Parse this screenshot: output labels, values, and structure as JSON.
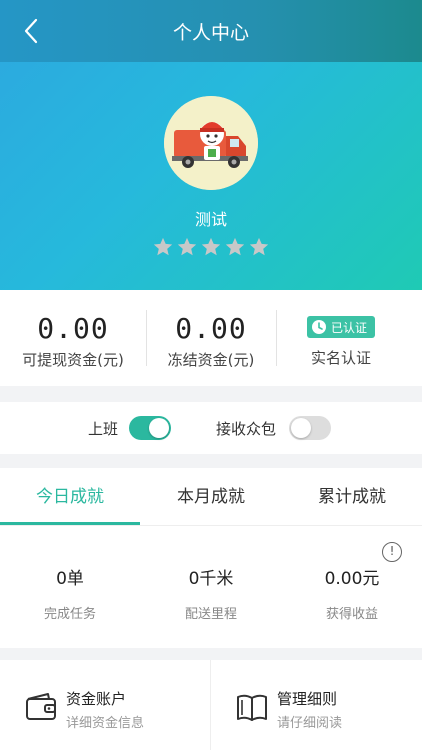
{
  "header": {
    "title": "个人中心"
  },
  "profile": {
    "name": "测试",
    "rating": 5
  },
  "stats": {
    "withdrawable_value": "0.00",
    "withdrawable_label": "可提现资金(元)",
    "frozen_value": "0.00",
    "frozen_label": "冻结资金(元)",
    "verify_badge": "已认证",
    "verify_label": "实名认证"
  },
  "toggles": {
    "work_label": "上班",
    "work_on": true,
    "crowd_label": "接收众包",
    "crowd_on": false
  },
  "achievements": {
    "tabs": [
      "今日成就",
      "本月成就",
      "累计成就"
    ],
    "active_tab": 0,
    "info_glyph": "!",
    "metrics": [
      {
        "value": "0单",
        "label": "完成任务"
      },
      {
        "value": "0千米",
        "label": "配送里程"
      },
      {
        "value": "0.00元",
        "label": "获得收益"
      }
    ]
  },
  "entries": [
    {
      "title": "资金账户",
      "subtitle": "详细资金信息",
      "icon": "wallet-icon"
    },
    {
      "title": "管理细则",
      "subtitle": "请仔细阅读",
      "icon": "book-icon"
    }
  ],
  "colors": {
    "accent": "#2bb89f",
    "switch_off": "#dddddd",
    "star": "#c8c8c8"
  }
}
